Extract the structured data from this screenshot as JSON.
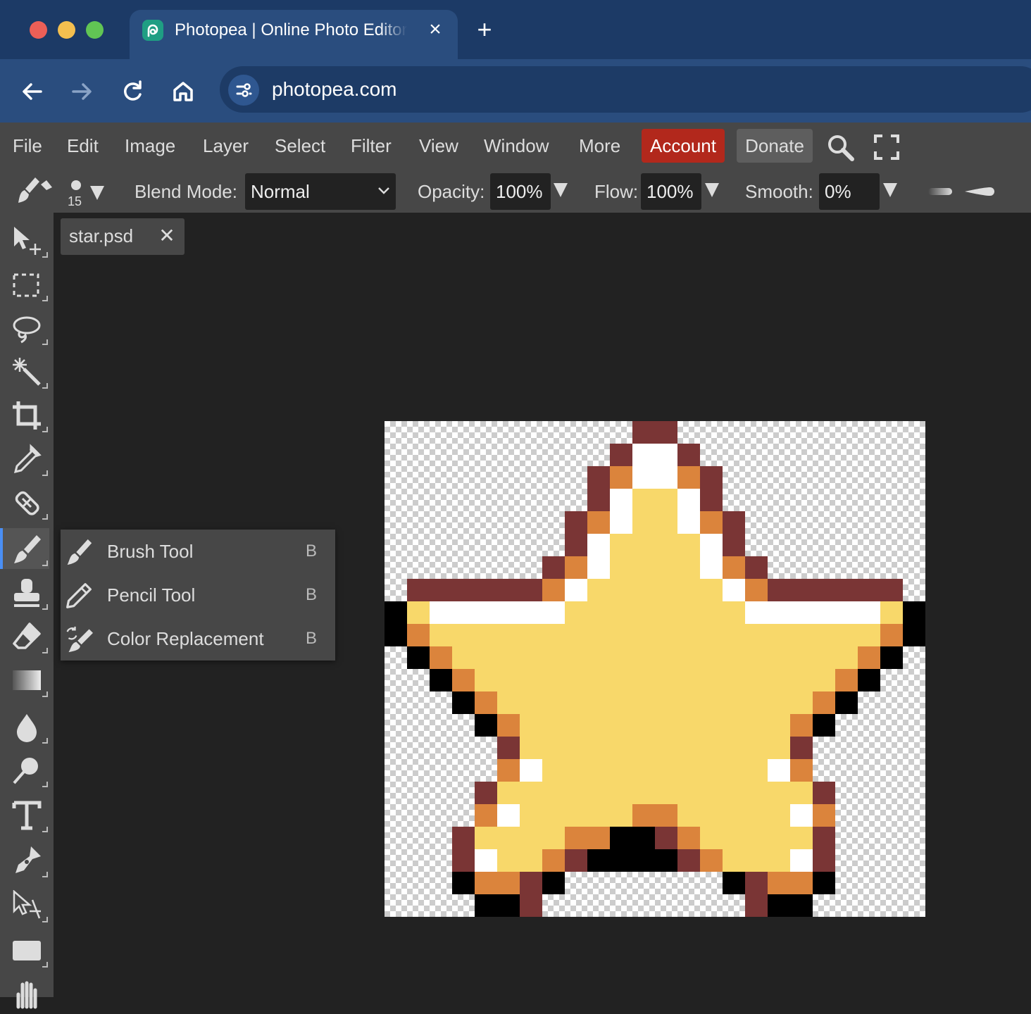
{
  "browser": {
    "tab_title": "Photopea | Online Photo Editor",
    "url": "photopea.com"
  },
  "menu": {
    "items": [
      "File",
      "Edit",
      "Image",
      "Layer",
      "Select",
      "Filter",
      "View",
      "Window",
      "More"
    ],
    "account": "Account",
    "donate": "Donate"
  },
  "options": {
    "brush_size": "15",
    "blend_label": "Blend Mode:",
    "blend_value": "Normal",
    "opacity_label": "Opacity:",
    "opacity_value": "100%",
    "flow_label": "Flow:",
    "flow_value": "100%",
    "smooth_label": "Smooth:",
    "smooth_value": "0%"
  },
  "document": {
    "tab_name": "star.psd"
  },
  "flyout": {
    "items": [
      {
        "label": "Brush Tool",
        "key": "B",
        "icon": "brush-icon"
      },
      {
        "label": "Pencil Tool",
        "key": "B",
        "icon": "pencil-icon"
      },
      {
        "label": "Color Replacement",
        "key": "B",
        "icon": "color-replacement-icon"
      }
    ]
  },
  "tools": [
    "move",
    "rect-select",
    "lasso",
    "magic-wand",
    "crop",
    "eyedropper",
    "healing",
    "brush",
    "stamp",
    "eraser",
    "gradient",
    "blur",
    "dodge",
    "type",
    "pen",
    "path-select",
    "rectangle",
    "hand"
  ],
  "pixel_art": {
    "palette": {
      "D": "#7a3535",
      "O": "#db843c",
      "W": "#ffffff",
      "Y": "#f8d86a",
      "K": "#000000"
    },
    "rows": [
      "...........DD..........",
      "..........DWWD.........",
      ".........DOWWOD........",
      ".........DWYYWD........",
      "........DOWYYWOD.......",
      "........DWYYYYWD.......",
      ".......DOWYYYYWOD......",
      ".DDDDDDOWYYYYYYWODDDDDD",
      "KYWWWWWWYYYYYYYYWWWWWWYK",
      "KOYYYYYYYYYYYYYYYYYYYYOK",
      ".KOYYYYYYYYYYYYYYYYYYOK.",
      "..KOYYYYYYYYYYYYYYYYOK..",
      "...KOYYYYYYYYYYYYYYOK...",
      "....KOYYYYYYYYYYYYOK....",
      ".....DYYYYYYYYYYYYD.....",
      ".....OWYYYYYYYYYYWO.....",
      "....DYYYYYYYYYYYYYYD....",
      "....OWYYYYYOOYYYYYWO....",
      "...DYYYYOOKKDOYYYYYD....",
      "...DWYYODKKKKDOYYYWD....",
      "...KOODK.......KDOOK....",
      "....KKD.........DKK....."
    ]
  }
}
